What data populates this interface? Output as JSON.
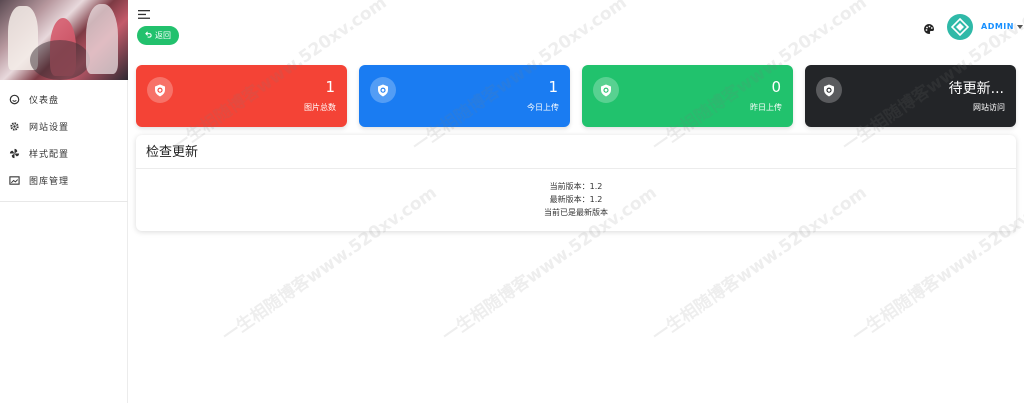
{
  "sidebar": {
    "items": [
      {
        "label": "仪表盘",
        "icon": "dashboard-icon"
      },
      {
        "label": "网站设置",
        "icon": "gear-icon"
      },
      {
        "label": "样式配置",
        "icon": "pinwheel-icon"
      },
      {
        "label": "图库管理",
        "icon": "image-icon"
      }
    ]
  },
  "header": {
    "back_label": "返回",
    "user_name": "ADMIN"
  },
  "cards": [
    {
      "value": "1",
      "label": "图片总数",
      "color": "#f44336"
    },
    {
      "value": "1",
      "label": "今日上传",
      "color": "#1a7cf2"
    },
    {
      "value": "0",
      "label": "昨日上传",
      "color": "#21c26d"
    },
    {
      "value": "待更新...",
      "label": "网站访问",
      "color": "#232528"
    }
  ],
  "update_panel": {
    "title": "检查更新",
    "current_version": "当前版本：1.2",
    "latest_version": "最新版本：1.2",
    "status": "当前已是最新版本"
  },
  "watermark": "一生相随博客www.520xv.com"
}
